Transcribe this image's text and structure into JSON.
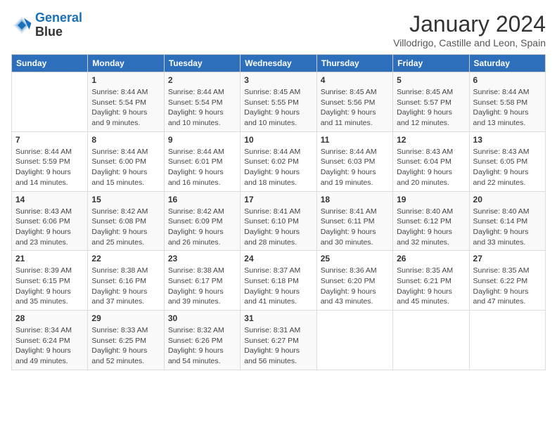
{
  "header": {
    "logo_line1": "General",
    "logo_line2": "Blue",
    "month": "January 2024",
    "location": "Villodrigo, Castille and Leon, Spain"
  },
  "days_of_week": [
    "Sunday",
    "Monday",
    "Tuesday",
    "Wednesday",
    "Thursday",
    "Friday",
    "Saturday"
  ],
  "weeks": [
    [
      {
        "day": "",
        "sunrise": "",
        "sunset": "",
        "daylight": ""
      },
      {
        "day": "1",
        "sunrise": "Sunrise: 8:44 AM",
        "sunset": "Sunset: 5:54 PM",
        "daylight": "Daylight: 9 hours and 9 minutes."
      },
      {
        "day": "2",
        "sunrise": "Sunrise: 8:44 AM",
        "sunset": "Sunset: 5:54 PM",
        "daylight": "Daylight: 9 hours and 10 minutes."
      },
      {
        "day": "3",
        "sunrise": "Sunrise: 8:45 AM",
        "sunset": "Sunset: 5:55 PM",
        "daylight": "Daylight: 9 hours and 10 minutes."
      },
      {
        "day": "4",
        "sunrise": "Sunrise: 8:45 AM",
        "sunset": "Sunset: 5:56 PM",
        "daylight": "Daylight: 9 hours and 11 minutes."
      },
      {
        "day": "5",
        "sunrise": "Sunrise: 8:45 AM",
        "sunset": "Sunset: 5:57 PM",
        "daylight": "Daylight: 9 hours and 12 minutes."
      },
      {
        "day": "6",
        "sunrise": "Sunrise: 8:44 AM",
        "sunset": "Sunset: 5:58 PM",
        "daylight": "Daylight: 9 hours and 13 minutes."
      }
    ],
    [
      {
        "day": "7",
        "sunrise": "Sunrise: 8:44 AM",
        "sunset": "Sunset: 5:59 PM",
        "daylight": "Daylight: 9 hours and 14 minutes."
      },
      {
        "day": "8",
        "sunrise": "Sunrise: 8:44 AM",
        "sunset": "Sunset: 6:00 PM",
        "daylight": "Daylight: 9 hours and 15 minutes."
      },
      {
        "day": "9",
        "sunrise": "Sunrise: 8:44 AM",
        "sunset": "Sunset: 6:01 PM",
        "daylight": "Daylight: 9 hours and 16 minutes."
      },
      {
        "day": "10",
        "sunrise": "Sunrise: 8:44 AM",
        "sunset": "Sunset: 6:02 PM",
        "daylight": "Daylight: 9 hours and 18 minutes."
      },
      {
        "day": "11",
        "sunrise": "Sunrise: 8:44 AM",
        "sunset": "Sunset: 6:03 PM",
        "daylight": "Daylight: 9 hours and 19 minutes."
      },
      {
        "day": "12",
        "sunrise": "Sunrise: 8:43 AM",
        "sunset": "Sunset: 6:04 PM",
        "daylight": "Daylight: 9 hours and 20 minutes."
      },
      {
        "day": "13",
        "sunrise": "Sunrise: 8:43 AM",
        "sunset": "Sunset: 6:05 PM",
        "daylight": "Daylight: 9 hours and 22 minutes."
      }
    ],
    [
      {
        "day": "14",
        "sunrise": "Sunrise: 8:43 AM",
        "sunset": "Sunset: 6:06 PM",
        "daylight": "Daylight: 9 hours and 23 minutes."
      },
      {
        "day": "15",
        "sunrise": "Sunrise: 8:42 AM",
        "sunset": "Sunset: 6:08 PM",
        "daylight": "Daylight: 9 hours and 25 minutes."
      },
      {
        "day": "16",
        "sunrise": "Sunrise: 8:42 AM",
        "sunset": "Sunset: 6:09 PM",
        "daylight": "Daylight: 9 hours and 26 minutes."
      },
      {
        "day": "17",
        "sunrise": "Sunrise: 8:41 AM",
        "sunset": "Sunset: 6:10 PM",
        "daylight": "Daylight: 9 hours and 28 minutes."
      },
      {
        "day": "18",
        "sunrise": "Sunrise: 8:41 AM",
        "sunset": "Sunset: 6:11 PM",
        "daylight": "Daylight: 9 hours and 30 minutes."
      },
      {
        "day": "19",
        "sunrise": "Sunrise: 8:40 AM",
        "sunset": "Sunset: 6:12 PM",
        "daylight": "Daylight: 9 hours and 32 minutes."
      },
      {
        "day": "20",
        "sunrise": "Sunrise: 8:40 AM",
        "sunset": "Sunset: 6:14 PM",
        "daylight": "Daylight: 9 hours and 33 minutes."
      }
    ],
    [
      {
        "day": "21",
        "sunrise": "Sunrise: 8:39 AM",
        "sunset": "Sunset: 6:15 PM",
        "daylight": "Daylight: 9 hours and 35 minutes."
      },
      {
        "day": "22",
        "sunrise": "Sunrise: 8:38 AM",
        "sunset": "Sunset: 6:16 PM",
        "daylight": "Daylight: 9 hours and 37 minutes."
      },
      {
        "day": "23",
        "sunrise": "Sunrise: 8:38 AM",
        "sunset": "Sunset: 6:17 PM",
        "daylight": "Daylight: 9 hours and 39 minutes."
      },
      {
        "day": "24",
        "sunrise": "Sunrise: 8:37 AM",
        "sunset": "Sunset: 6:18 PM",
        "daylight": "Daylight: 9 hours and 41 minutes."
      },
      {
        "day": "25",
        "sunrise": "Sunrise: 8:36 AM",
        "sunset": "Sunset: 6:20 PM",
        "daylight": "Daylight: 9 hours and 43 minutes."
      },
      {
        "day": "26",
        "sunrise": "Sunrise: 8:35 AM",
        "sunset": "Sunset: 6:21 PM",
        "daylight": "Daylight: 9 hours and 45 minutes."
      },
      {
        "day": "27",
        "sunrise": "Sunrise: 8:35 AM",
        "sunset": "Sunset: 6:22 PM",
        "daylight": "Daylight: 9 hours and 47 minutes."
      }
    ],
    [
      {
        "day": "28",
        "sunrise": "Sunrise: 8:34 AM",
        "sunset": "Sunset: 6:24 PM",
        "daylight": "Daylight: 9 hours and 49 minutes."
      },
      {
        "day": "29",
        "sunrise": "Sunrise: 8:33 AM",
        "sunset": "Sunset: 6:25 PM",
        "daylight": "Daylight: 9 hours and 52 minutes."
      },
      {
        "day": "30",
        "sunrise": "Sunrise: 8:32 AM",
        "sunset": "Sunset: 6:26 PM",
        "daylight": "Daylight: 9 hours and 54 minutes."
      },
      {
        "day": "31",
        "sunrise": "Sunrise: 8:31 AM",
        "sunset": "Sunset: 6:27 PM",
        "daylight": "Daylight: 9 hours and 56 minutes."
      },
      {
        "day": "",
        "sunrise": "",
        "sunset": "",
        "daylight": ""
      },
      {
        "day": "",
        "sunrise": "",
        "sunset": "",
        "daylight": ""
      },
      {
        "day": "",
        "sunrise": "",
        "sunset": "",
        "daylight": ""
      }
    ]
  ]
}
